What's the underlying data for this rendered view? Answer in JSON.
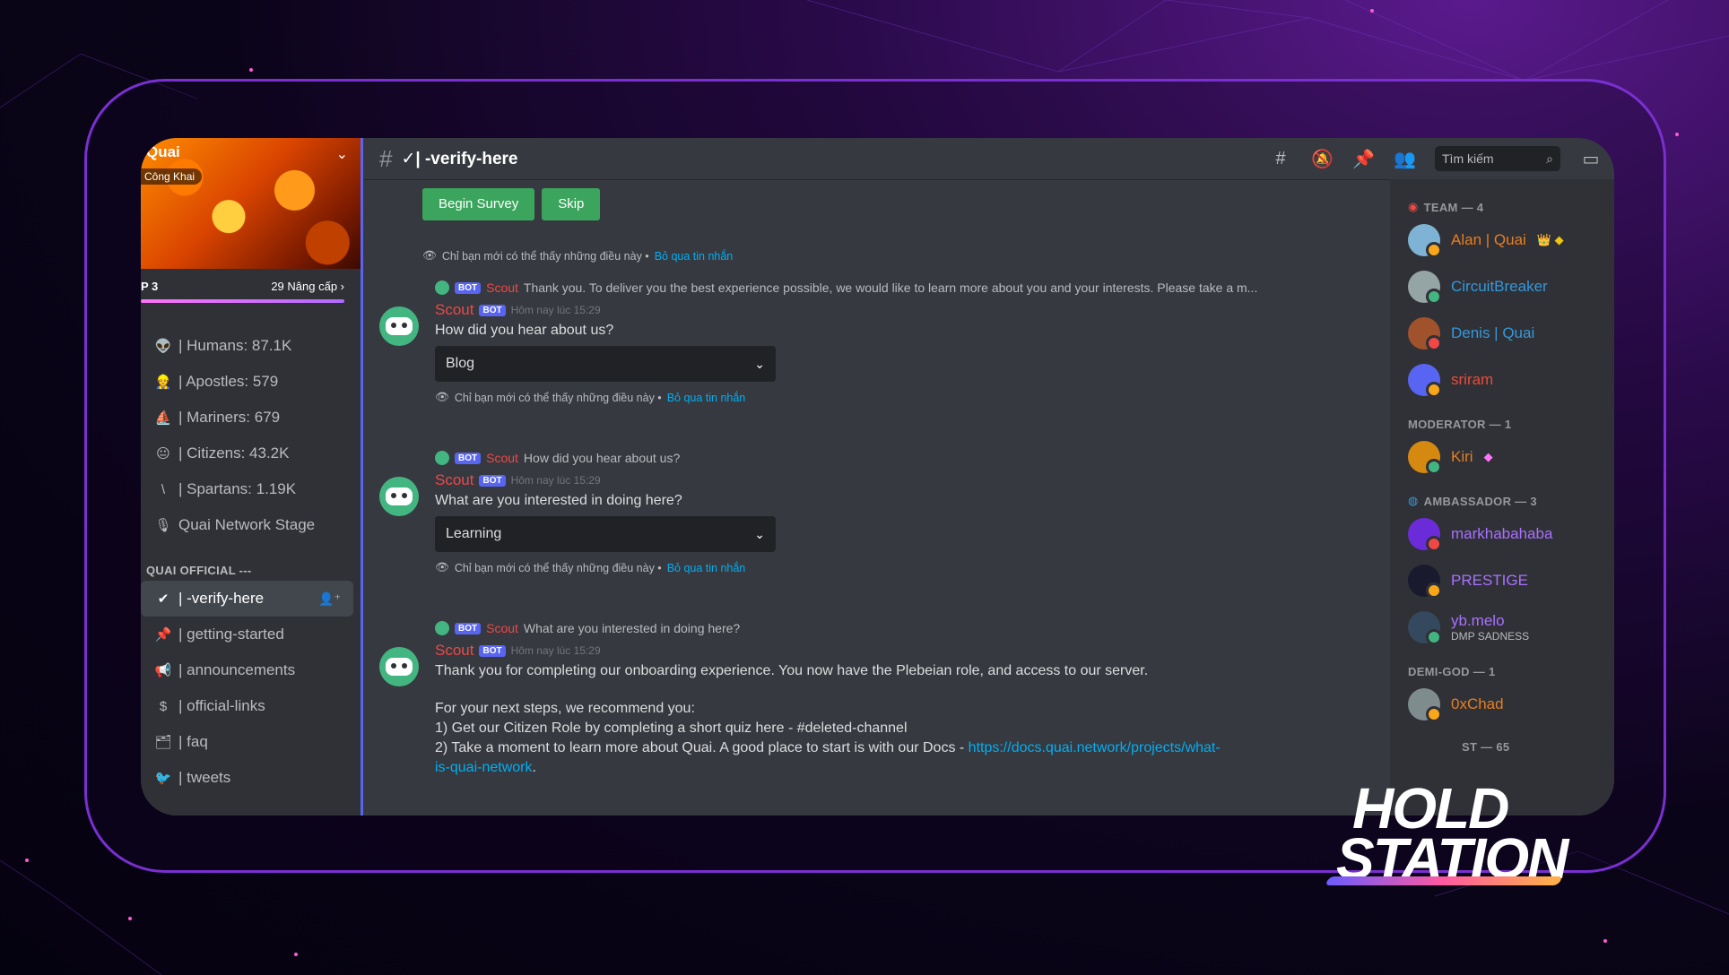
{
  "server": {
    "name": "Quai",
    "public_badge": "Công Khai",
    "boost_level": "P 3",
    "boost_count": "29 Nâng cấp ›"
  },
  "stats": [
    {
      "icon": "👽",
      "label": "| Humans: 87.1K"
    },
    {
      "icon": "👷",
      "label": "| Apostles: 579"
    },
    {
      "icon": "⛵",
      "label": "| Mariners: 679"
    },
    {
      "icon": "😐",
      "label": "| Citizens: 43.2K"
    },
    {
      "icon": "\\",
      "label": "| Spartans: 1.19K"
    },
    {
      "icon": "🎙",
      "label": "Quai Network Stage"
    }
  ],
  "category": "QUAI OFFICIAL ---",
  "channels": [
    {
      "icon": "✔",
      "label": "| -verify-here",
      "active": true
    },
    {
      "icon": "📌",
      "label": "| getting-started"
    },
    {
      "icon": "📢",
      "label": "| announcements"
    },
    {
      "icon": "$",
      "label": "| official-links"
    },
    {
      "icon": "🗂",
      "label": "| faq"
    },
    {
      "icon": "🐦",
      "label": "| tweets"
    }
  ],
  "topbar": {
    "channel": "✓| -verify-here",
    "search_placeholder": "Tìm kiếm"
  },
  "buttons": {
    "begin": "Begin Survey",
    "skip": "Skip"
  },
  "ephemeral": {
    "text": "Chỉ bạn mới có thể thấy những điều này •",
    "link": "Bỏ qua tin nhắn"
  },
  "bot": {
    "name": "Scout",
    "tag": "BOT",
    "timestamp": "Hôm nay lúc 15:29"
  },
  "messages": [
    {
      "reply": "Thank you. To deliver you the best experience possible, we would like to learn more about you and your interests. Please take a m...",
      "text": "How did you hear about us?",
      "select": "Blog"
    },
    {
      "reply": "How did you hear about us?",
      "text": "What are you interested in doing here?",
      "select": "Learning"
    },
    {
      "reply": "What are you interested in doing here?",
      "text": "Thank you for completing our onboarding experience. You now have the Plebeian role, and access to our server.",
      "line2": "For your next steps, we recommend you:",
      "line3": "1) Get our Citizen Role by completing a short quiz here - #deleted-channel",
      "line4": "2) Take a moment to learn more about Quai. A good place to start is with our Docs - ",
      "link1": "https://docs.quai.network/projects/what-",
      "link2": "is-quai-network",
      "end": "."
    }
  ],
  "members": {
    "team": "TEAM — 4",
    "team_list": [
      {
        "name": "Alan | Quai",
        "color": "#e67e22",
        "extra": "👑 ◆"
      },
      {
        "name": "CircuitBreaker",
        "color": "#3498db"
      },
      {
        "name": "Denis | Quai",
        "color": "#3498db"
      },
      {
        "name": "sriram",
        "color": "#e74c3c"
      }
    ],
    "moderator": "MODERATOR — 1",
    "mod_list": [
      {
        "name": "Kiri",
        "color": "#e67e22",
        "extra": "◆"
      }
    ],
    "ambassador": "AMBASSADOR — 3",
    "amb_list": [
      {
        "name": "markhabahaba",
        "color": "#a970ff"
      },
      {
        "name": "PRESTIGE",
        "color": "#a970ff"
      },
      {
        "name": "yb.melo",
        "color": "#a970ff",
        "sub": "DMP SADNESS"
      }
    ],
    "demigod": "DEMI-GOD — 1",
    "demi_list": [
      {
        "name": "0xChad",
        "color": "#e67e22"
      }
    ],
    "partial": "ST — 65"
  },
  "logo": {
    "line1": "HOLD",
    "line2": "STATION"
  }
}
